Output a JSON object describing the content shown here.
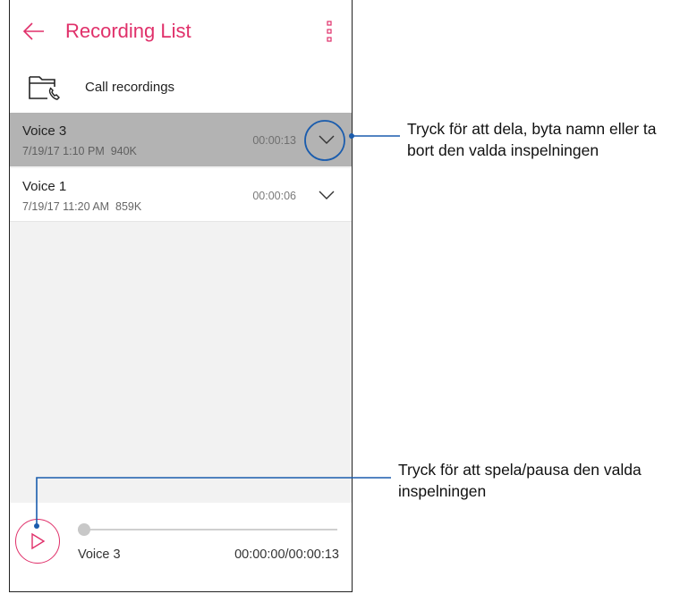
{
  "header": {
    "title": "Recording List"
  },
  "call_folder": {
    "label": "Call recordings"
  },
  "recordings": [
    {
      "name": "Voice 3",
      "date": "7/19/17 1:10 PM",
      "size": "940K",
      "duration": "00:00:13",
      "selected": true
    },
    {
      "name": "Voice 1",
      "date": "7/19/17 11:20 AM",
      "size": "859K",
      "duration": "00:00:06",
      "selected": false
    }
  ],
  "player": {
    "name": "Voice 3",
    "time": "00:00:00/00:00:13",
    "progress": 0
  },
  "callouts": {
    "expand": {
      "line1": "Tryck för att dela, byta namn eller ta",
      "line2": "bort den valda inspelningen"
    },
    "play": {
      "line1": "Tryck för att spela/pausa den valda",
      "line2": "inspelningen"
    }
  },
  "colors": {
    "accent": "#e0306a",
    "callout_line": "#1a5cad",
    "selected_row": "#b3b3b3"
  },
  "icons": {
    "back": "arrow-left-icon",
    "menu": "vertical-dots-icon",
    "folder": "call-folder-icon",
    "expand": "chevron-down-icon",
    "play": "play-icon"
  }
}
